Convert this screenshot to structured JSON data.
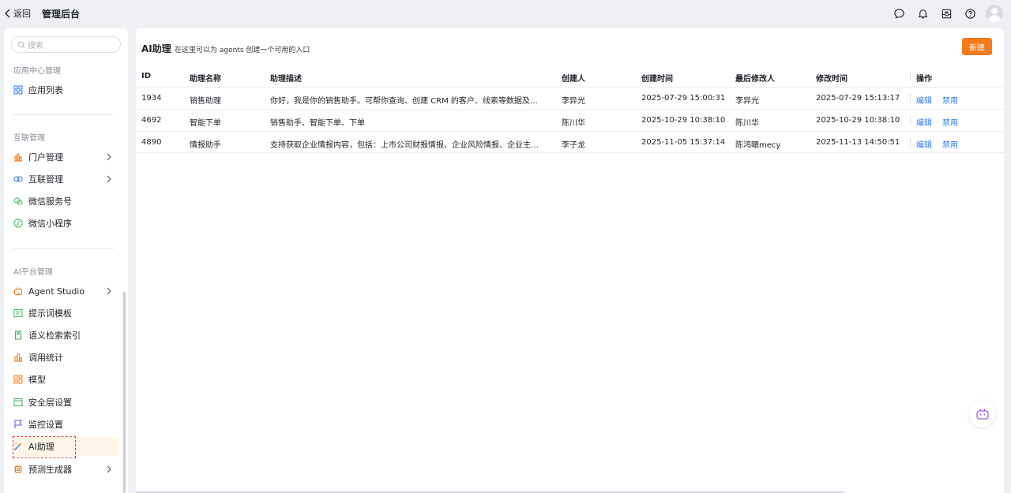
{
  "topbar": {
    "back_label": "返回",
    "title": "管理后台"
  },
  "sidebar": {
    "search_placeholder": "搜索",
    "sections": [
      {
        "title": "应用中心管理",
        "items": [
          {
            "label": "应用列表",
            "icon": "grid-icon"
          }
        ]
      },
      {
        "title": "互联管理",
        "items": [
          {
            "label": "门户管理",
            "icon": "portal-icon",
            "has_children": true
          },
          {
            "label": "互联管理",
            "icon": "link-circles-icon",
            "has_children": true
          },
          {
            "label": "微信服务号",
            "icon": "wechat-icon"
          },
          {
            "label": "微信小程序",
            "icon": "miniprogram-icon"
          }
        ]
      },
      {
        "title": "AI平台管理",
        "items": [
          {
            "label": "Agent Studio",
            "icon": "robot-icon",
            "has_children": true
          },
          {
            "label": "提示词模板",
            "icon": "template-icon"
          },
          {
            "label": "语义检索索引",
            "icon": "index-icon"
          },
          {
            "label": "调用统计",
            "icon": "stats-icon"
          },
          {
            "label": "模型",
            "icon": "model-icon"
          },
          {
            "label": "安全层设置",
            "icon": "security-layer-icon"
          },
          {
            "label": "监控设置",
            "icon": "flag-icon"
          },
          {
            "label": "AI助理",
            "icon": "magic-wand-icon",
            "active": true
          },
          {
            "label": "预测生成器",
            "icon": "chip-icon",
            "has_children": true
          }
        ]
      }
    ]
  },
  "main": {
    "title": "AI助理",
    "subtitle": "在这里可以为 agents 创建一个可用的入口",
    "new_button": "新建",
    "columns": [
      "ID",
      "助理名称",
      "助理描述",
      "创建人",
      "创建时间",
      "最后修改人",
      "修改时间",
      "操作"
    ],
    "rows": [
      [
        "1934",
        "销售助理",
        "你好，我是你的销售助手。可帮你查询、创建 CRM 的客户、线索等数据及…",
        "李异光",
        "2025-07-29 15:00:31",
        "李异光",
        "2025-07-29 15:13:17"
      ],
      [
        "4692",
        "智能下单",
        "销售助手、智能下单、下单",
        "陈川华",
        "2025-10-29 10:38:10",
        "陈川华",
        "2025-10-29 10:38:10"
      ],
      [
        "4890",
        "情报助手",
        "支持获取企业情报内容，包括：上市公司财报情报、企业风险情报、企业主…",
        "李子龙",
        "2025-11-05 15:37:14",
        "陈鸿曦mecy",
        "2025-11-13 14:50:51"
      ]
    ],
    "actions": {
      "edit": "编辑",
      "disable": "禁用"
    }
  },
  "colors": {
    "accent": "#f57a1a",
    "link": "#2f7bf0",
    "active_bg": "#fff6e8"
  }
}
